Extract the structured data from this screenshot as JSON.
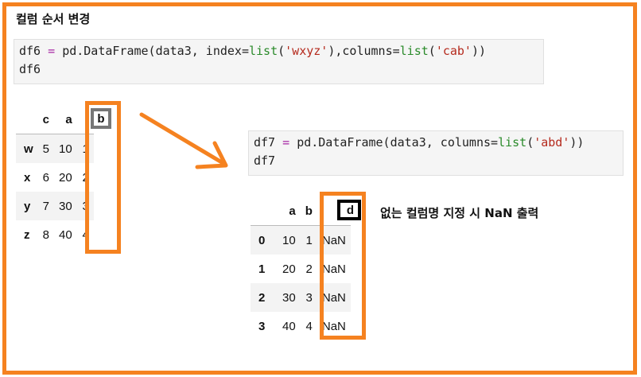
{
  "title": "컬럼 순서 변경",
  "cell1": {
    "line1_parts": [
      "df6",
      " = ",
      "pd.DataFrame(data3, index=",
      "list",
      "(",
      "'wxyz'",
      "),columns=",
      "list",
      "(",
      "'cab'",
      "))"
    ],
    "line2": "df6"
  },
  "df6": {
    "columns": [
      "c",
      "a",
      "b"
    ],
    "rows": [
      {
        "index": "w",
        "values": [
          "5",
          "10",
          "1"
        ]
      },
      {
        "index": "x",
        "values": [
          "6",
          "20",
          "2"
        ]
      },
      {
        "index": "y",
        "values": [
          "7",
          "30",
          "3"
        ]
      },
      {
        "index": "z",
        "values": [
          "8",
          "40",
          "4"
        ]
      }
    ]
  },
  "cell2": {
    "line1_parts": [
      "df7",
      " = ",
      "pd.DataFrame(data3, columns=",
      "list",
      "(",
      "'abd'",
      "))"
    ],
    "line2": "df7"
  },
  "df7": {
    "columns": [
      "a",
      "b",
      "d"
    ],
    "rows": [
      {
        "index": "0",
        "values": [
          "10",
          "1",
          "NaN"
        ]
      },
      {
        "index": "1",
        "values": [
          "20",
          "2",
          "NaN"
        ]
      },
      {
        "index": "2",
        "values": [
          "30",
          "3",
          "NaN"
        ]
      },
      {
        "index": "3",
        "values": [
          "40",
          "4",
          "NaN"
        ]
      }
    ]
  },
  "note": "없는 컬럼명 지정 시 NaN 출력",
  "colors": {
    "highlight": "#f58220"
  }
}
